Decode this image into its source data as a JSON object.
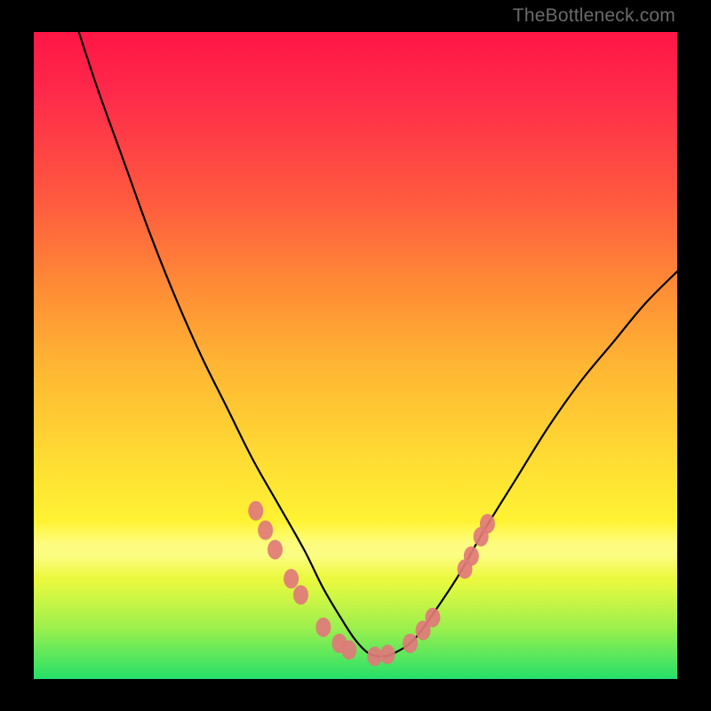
{
  "watermark": "TheBottleneck.com",
  "colors": {
    "frame": "#000000",
    "curve_stroke": "#000000",
    "marker_fill": "#e07a7a",
    "marker_stroke": "#c95b5b"
  },
  "chart_data": {
    "type": "line",
    "title": "",
    "xlabel": "",
    "ylabel": "",
    "xlim": [
      0,
      100
    ],
    "ylim": [
      0,
      100
    ],
    "grid": false,
    "legend": false,
    "series": [
      {
        "name": "curve",
        "x": [
          7,
          10,
          14,
          18,
          22,
          26,
          30,
          34,
          38,
          42,
          45,
          48,
          50,
          52,
          54,
          56,
          59,
          62,
          66,
          70,
          75,
          80,
          85,
          90,
          95,
          100
        ],
        "y": [
          100,
          91,
          80,
          69,
          59,
          50,
          42,
          34,
          27,
          20,
          14,
          9,
          6,
          4,
          3.5,
          4,
          6,
          10,
          16,
          23,
          31,
          39,
          46,
          52,
          58,
          63
        ]
      }
    ],
    "markers": [
      {
        "x": 34.5,
        "y": 26
      },
      {
        "x": 36.0,
        "y": 23
      },
      {
        "x": 37.5,
        "y": 20
      },
      {
        "x": 40.0,
        "y": 15.5
      },
      {
        "x": 41.5,
        "y": 13
      },
      {
        "x": 45.0,
        "y": 8
      },
      {
        "x": 47.5,
        "y": 5.5
      },
      {
        "x": 49.0,
        "y": 4.5
      },
      {
        "x": 53.0,
        "y": 3.5
      },
      {
        "x": 55.0,
        "y": 3.8
      },
      {
        "x": 58.5,
        "y": 5.5
      },
      {
        "x": 60.5,
        "y": 7.5
      },
      {
        "x": 62.0,
        "y": 9.5
      },
      {
        "x": 67.0,
        "y": 17
      },
      {
        "x": 68.0,
        "y": 19
      },
      {
        "x": 69.5,
        "y": 22
      },
      {
        "x": 70.5,
        "y": 24
      }
    ]
  }
}
